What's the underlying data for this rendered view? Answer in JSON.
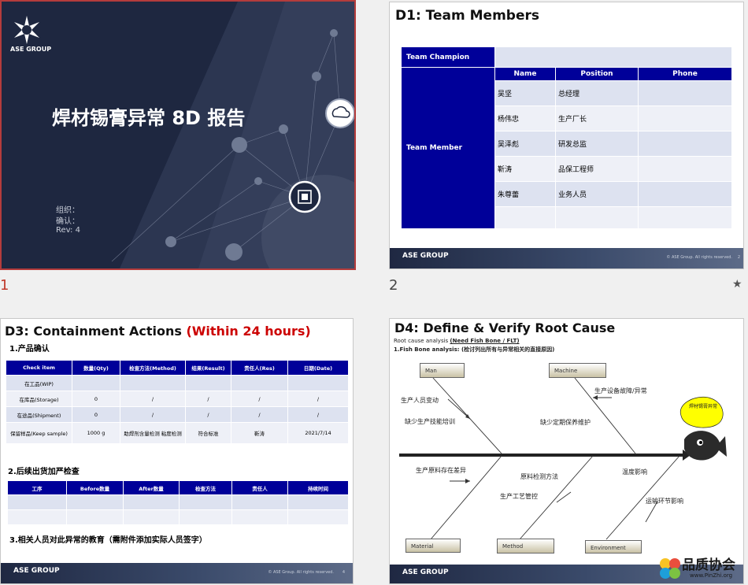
{
  "slides": [
    {
      "number": "1",
      "brand": "ASE GROUP",
      "title": "焊材锡膏异常 8D 报告",
      "meta": [
        "组织：",
        "确认：",
        "Rev: 4"
      ]
    },
    {
      "number": "2",
      "star": "★",
      "title": "D1: Team Members",
      "champion_label": "Team Champion",
      "member_label": "Team Member",
      "headers": [
        "Name",
        "Position",
        "Phone"
      ],
      "rows": [
        [
          "吴坚",
          "总经理",
          ""
        ],
        [
          "杨伟忠",
          "生产厂长",
          ""
        ],
        [
          "吴泽彪",
          "研发总监",
          ""
        ],
        [
          "靳涛",
          "品保工程师",
          ""
        ],
        [
          "朱尊蕾",
          "业务人员",
          ""
        ],
        [
          "",
          "",
          ""
        ]
      ],
      "footer_brand": "ASE GROUP",
      "footer_copy": "© ASE Group. All rights reserved.",
      "page": "2"
    },
    {
      "title_main": "D3: Containment Actions",
      "title_red": "(Within 24 hours)",
      "section1": "1.产品确认",
      "table1_headers": [
        "Check item",
        "数量(Qty)",
        "检查方法(Method)",
        "结果(Result)",
        "责任人(Res)",
        "日期(Date)"
      ],
      "table1_rows": [
        [
          "在工品(WIP)",
          "",
          "",
          "",
          "",
          ""
        ],
        [
          "在库品(Storage)",
          "0",
          "/",
          "/",
          "/",
          "/"
        ],
        [
          "在途品(Shipment)",
          "0",
          "/",
          "/",
          "/",
          "/"
        ],
        [
          "保留样品(Keep sample)",
          "1000 g",
          "助焊剂含量检测 粘度检测",
          "符合标准",
          "靳涛",
          "2021/7/14"
        ]
      ],
      "section2": "2.后续出货加严检查",
      "table2_headers": [
        "工序",
        "Before数量",
        "After数量",
        "检查方法",
        "责任人",
        "持续时间"
      ],
      "table2_rows": [
        [
          "",
          "",
          "",
          "",
          "",
          ""
        ],
        [
          "",
          "",
          "",
          "",
          "",
          ""
        ]
      ],
      "section3": "3.相关人员对此异常的教育（需附件添加实际人员签字）",
      "footer_brand": "ASE GROUP",
      "footer_copy": "© ASE Group. All rights reserved.",
      "page": "4"
    },
    {
      "title": "D4: Define & Verify Root Cause",
      "sub1_a": "Root cause analysis ",
      "sub1_b": "(Need Fish Bone / FLT)",
      "sub2": "1.Fish Bone analysis: (检讨列出所有与异常相关的直接原因)",
      "boxes": {
        "man": "Man",
        "machine": "Machine",
        "material": "Material",
        "method": "Method",
        "environment": "Environment"
      },
      "causes": [
        "生产人员变动",
        "缺少生产技能培训",
        "生产设备故障/异常",
        "缺少定期保养维护",
        "生产原料存在差异",
        "原料检测方法",
        "生产工艺管控",
        "温度影响",
        "运输环节影响"
      ],
      "head_text": "焊材锡膏异常",
      "footer_brand": "ASE GROUP"
    }
  ],
  "watermark": {
    "text": "品质协会",
    "url": "www.PinZhi.org"
  },
  "colors": {
    "navy": "#000099",
    "row_light": "#dde2f0",
    "accent_red": "#cc0000",
    "slide1_bg": "#1e2740"
  }
}
